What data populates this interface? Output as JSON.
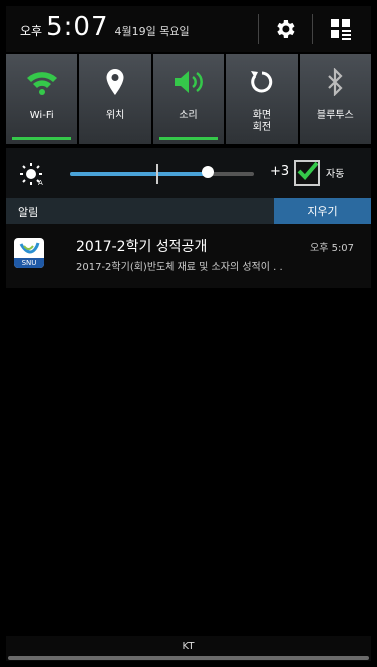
{
  "status": {
    "ampm": "오후",
    "time": "5:07",
    "date": "4월19일 목요일"
  },
  "toggles": [
    {
      "label": "Wi-Fi",
      "icon": "wifi-icon",
      "active": true,
      "accent": "#35c84a"
    },
    {
      "label": "위치",
      "icon": "location-icon",
      "active": false,
      "accent": "#35c84a"
    },
    {
      "label": "소리",
      "icon": "sound-icon",
      "active": true,
      "accent": "#35c84a"
    },
    {
      "label": "화면\n회전",
      "icon": "rotate-icon",
      "active": false,
      "accent": "#35c84a"
    },
    {
      "label": "블루투스",
      "icon": "bluetooth-icon",
      "active": false,
      "accent": "#35c84a"
    }
  ],
  "brightness": {
    "value_label": "+3",
    "level": 0.75,
    "auto_label": "자동",
    "auto_checked": true
  },
  "notifications": {
    "header": "알림",
    "clear_label": "지우기",
    "items": [
      {
        "app": "SNU",
        "title": "2017-2학기 성적공개",
        "time": "오후 5:07",
        "body": "2017-2학기(회)반도체 재료 및 소자의 성적이 . ."
      }
    ]
  },
  "carrier": "KT",
  "colors": {
    "accent_green": "#35c84a",
    "accent_blue": "#2b6aa0",
    "track_blue": "#4aa3d9"
  }
}
